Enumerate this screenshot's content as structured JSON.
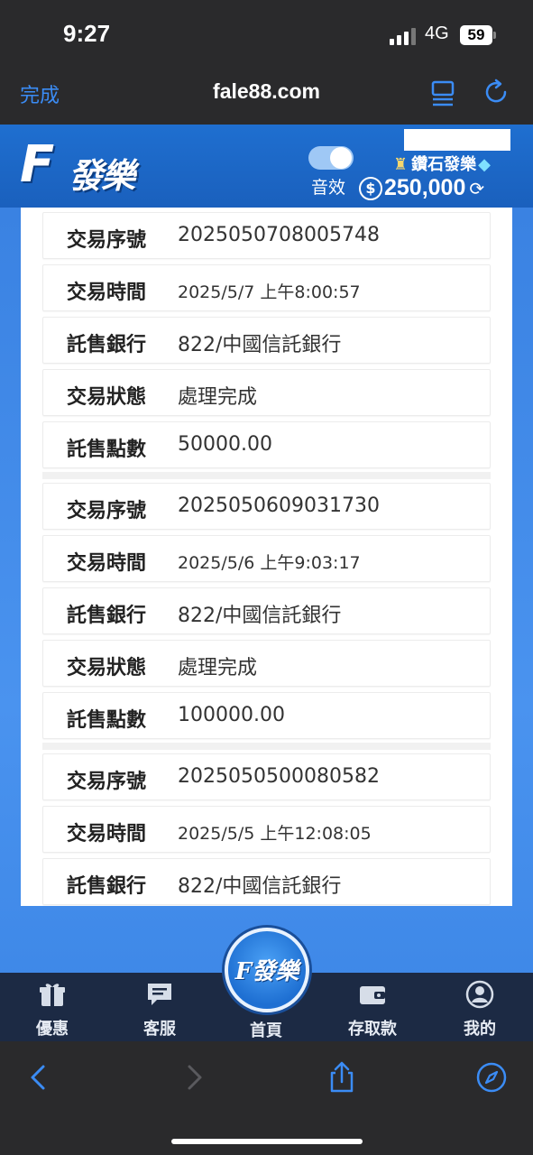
{
  "status_bar": {
    "time": "9:27",
    "network": "4G",
    "battery": "59"
  },
  "browser": {
    "done_label": "完成",
    "url": "fale88.com"
  },
  "header": {
    "logo_mark": "F",
    "logo_text": "發樂",
    "sound_label": "音效",
    "sound_on": true,
    "rank": "鑽石發樂",
    "balance": "250,000"
  },
  "records": [
    {
      "rows": [
        {
          "label": "交易序號",
          "value": "2025050708005748"
        },
        {
          "label": "交易時間",
          "value": "2025/5/7  上午8:00:57"
        },
        {
          "label": "託售銀行",
          "value": "822/中國信託銀行"
        },
        {
          "label": "交易狀態",
          "value": "處理完成"
        },
        {
          "label": "託售點數",
          "value": "50000.00"
        }
      ]
    },
    {
      "rows": [
        {
          "label": "交易序號",
          "value": "2025050609031730"
        },
        {
          "label": "交易時間",
          "value": "2025/5/6  上午9:03:17"
        },
        {
          "label": "託售銀行",
          "value": "822/中國信託銀行"
        },
        {
          "label": "交易狀態",
          "value": "處理完成"
        },
        {
          "label": "託售點數",
          "value": "100000.00"
        }
      ]
    },
    {
      "rows": [
        {
          "label": "交易序號",
          "value": "2025050500080582"
        },
        {
          "label": "交易時間",
          "value": "2025/5/5  上午12:08:05"
        },
        {
          "label": "託售銀行",
          "value": "822/中國信託銀行"
        }
      ]
    }
  ],
  "nav": {
    "items": [
      {
        "label": "優惠",
        "icon": "gift-icon"
      },
      {
        "label": "客服",
        "icon": "chat-icon"
      },
      {
        "label": "首頁",
        "icon": "home-logo"
      },
      {
        "label": "存取款",
        "icon": "wallet-icon"
      },
      {
        "label": "我的",
        "icon": "user-icon"
      }
    ],
    "home_logo": "F發樂"
  },
  "colors": {
    "accent": "#1f6fd0",
    "nav_bg": "#1c2a44",
    "ios_blue": "#3b8cf5"
  }
}
